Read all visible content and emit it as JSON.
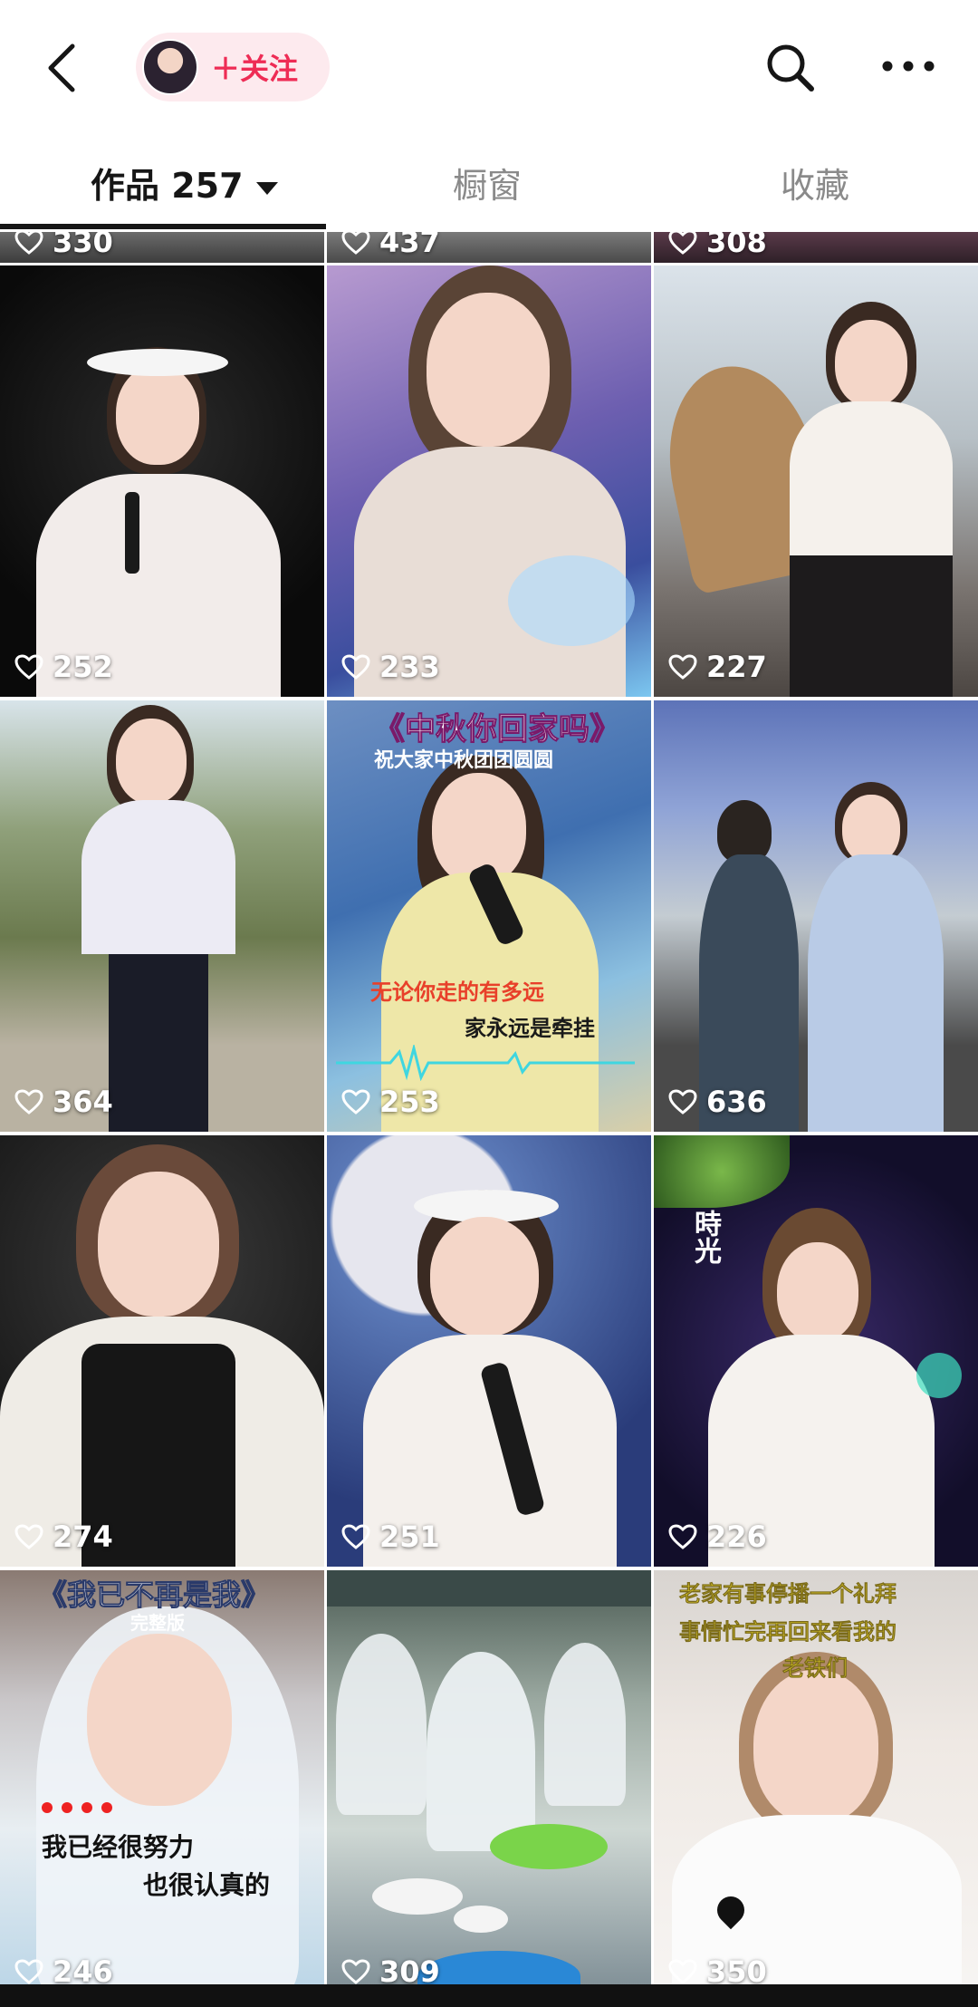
{
  "header": {
    "follow_label": "＋关注"
  },
  "tabs": [
    {
      "label": "作品 257",
      "active": true
    },
    {
      "label": "橱窗",
      "active": false
    },
    {
      "label": "收藏",
      "active": false
    }
  ],
  "grid": {
    "partial_row": [
      {
        "likes": "330"
      },
      {
        "likes": "437"
      },
      {
        "likes": "308"
      }
    ],
    "videos": [
      {
        "likes": "252"
      },
      {
        "likes": "233"
      },
      {
        "likes": "227"
      },
      {
        "likes": "364"
      },
      {
        "likes": "253",
        "title": "《中秋你回家吗》",
        "subtitle": "祝大家中秋团团圆圆",
        "caption1": "无论你走的有多远",
        "caption2": "家永远是牵挂"
      },
      {
        "likes": "636"
      },
      {
        "likes": "274"
      },
      {
        "likes": "251"
      },
      {
        "likes": "226",
        "side_text": "時光"
      },
      {
        "likes": "246",
        "title": "《我已不再是我》",
        "subtitle": "完整版",
        "caption1": "我已经很努力",
        "caption2": "也很认真的"
      },
      {
        "likes": "309"
      },
      {
        "likes": "350",
        "title": "老家有事停播一个礼拜",
        "caption1": "事情忙完再回来看我的",
        "caption2": "老铁们"
      }
    ]
  },
  "colors": {
    "accent": "#ee2c55",
    "follow_bg": "#fdeaee",
    "tab_active": "#161616",
    "tab_inactive": "#8a8a8a"
  }
}
